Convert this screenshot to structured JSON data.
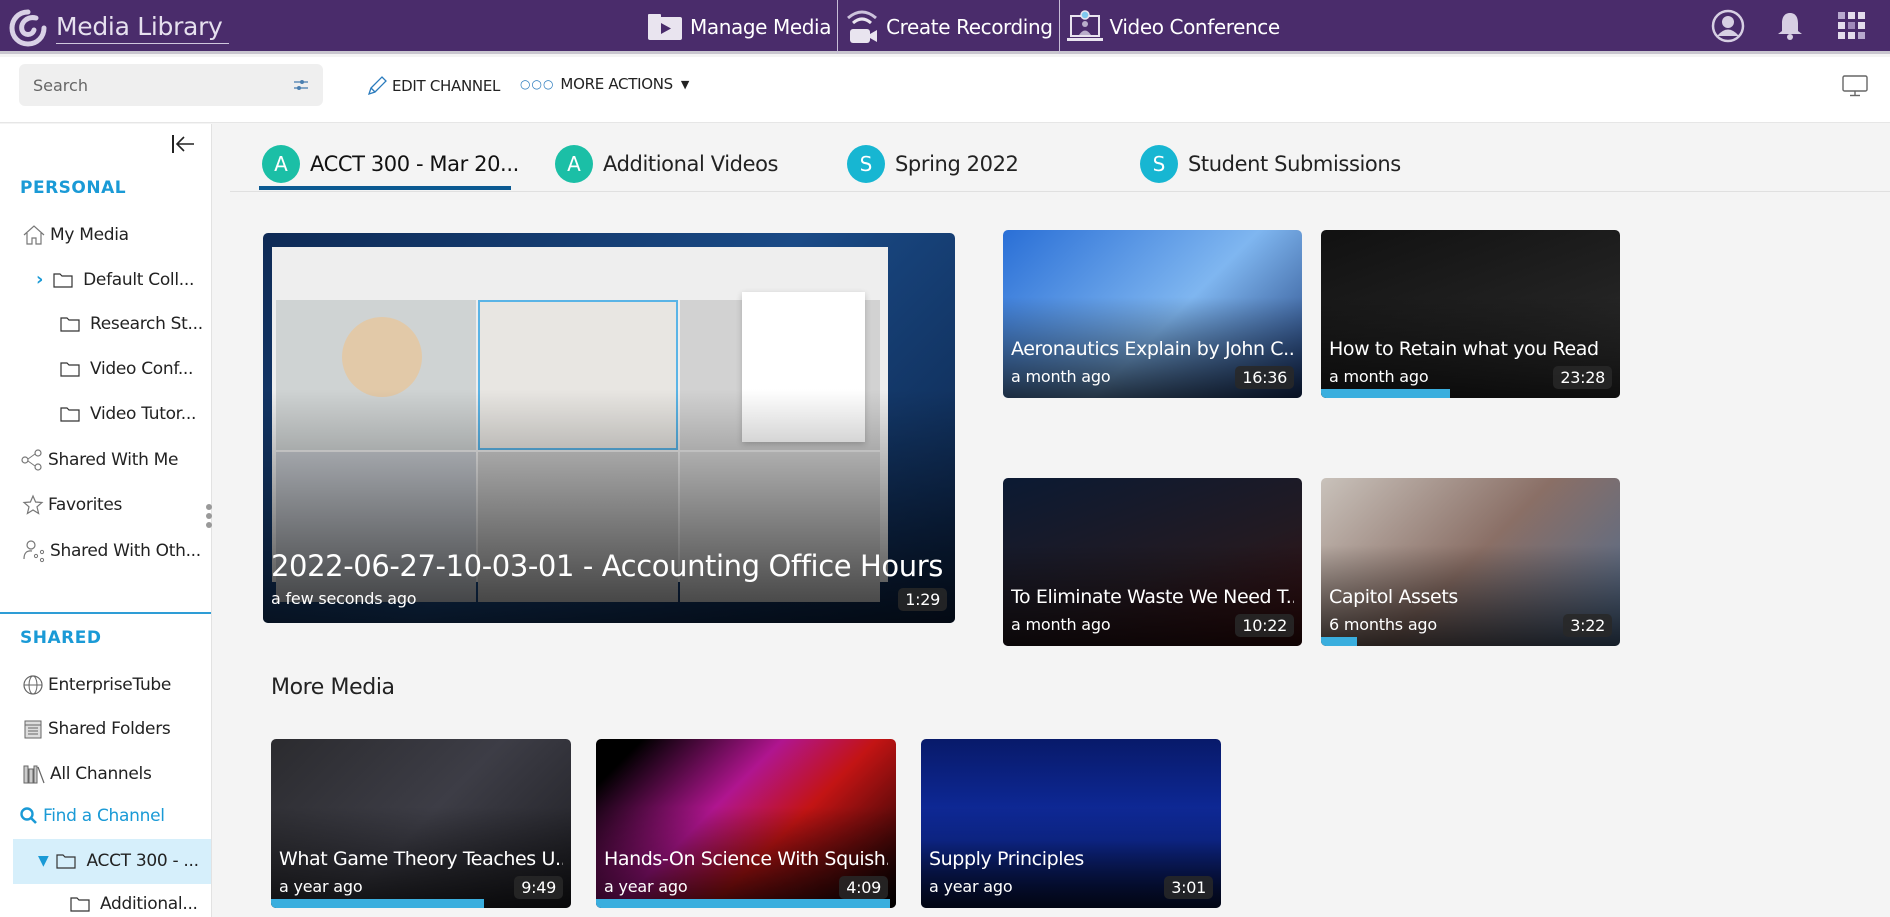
{
  "header": {
    "app_title": "Media Library",
    "nav": [
      {
        "label": "Manage Media",
        "icon": "play-folder-icon"
      },
      {
        "label": "Create Recording",
        "icon": "wireless-camera-icon"
      },
      {
        "label": "Video Conference",
        "icon": "laptop-person-icon"
      }
    ],
    "icons": [
      "user-profile-icon",
      "bell-icon",
      "apps-grid-icon"
    ]
  },
  "toolbar": {
    "search_placeholder": "Search",
    "edit_channel": "EDIT CHANNEL",
    "more_actions": "MORE ACTIONS",
    "more_dots": "○○○"
  },
  "sidebar": {
    "personal_title": "PERSONAL",
    "personal_items": [
      {
        "label": "My Media",
        "icon": "home-icon"
      },
      {
        "label": "Default Coll...",
        "icon": "folder-icon",
        "expander": "chevron-right"
      },
      {
        "label": "Research St...",
        "icon": "folder-icon"
      },
      {
        "label": "Video Conf...",
        "icon": "folder-icon"
      },
      {
        "label": "Video Tutor...",
        "icon": "folder-icon"
      },
      {
        "label": "Shared With Me",
        "icon": "share-icon"
      },
      {
        "label": "Favorites",
        "icon": "star-icon"
      },
      {
        "label": "Shared With Oth...",
        "icon": "user-share-icon"
      }
    ],
    "shared_title": "SHARED",
    "shared_items": [
      {
        "label": "EnterpriseTube",
        "icon": "globe-icon"
      },
      {
        "label": "Shared Folders",
        "icon": "building-icon"
      },
      {
        "label": "All Channels",
        "icon": "books-icon"
      },
      {
        "label": "Find a Channel",
        "icon": "search-icon"
      },
      {
        "label": "ACCT 300 - ...",
        "icon": "folder-icon",
        "expander": "chevron-down",
        "selected": true
      },
      {
        "label": "Additional...",
        "icon": "folder-icon"
      }
    ]
  },
  "tabs": [
    {
      "initial": "A",
      "label": "ACCT 300 - Mar 20...",
      "color": "#1bbfa6",
      "active": true
    },
    {
      "initial": "A",
      "label": "Additional Videos",
      "color": "#1bbfa6",
      "active": false
    },
    {
      "initial": "S",
      "label": "Spring 2022",
      "color": "#17b6d2",
      "active": false
    },
    {
      "initial": "S",
      "label": "Student Submissions",
      "color": "#17b6d2",
      "active": false
    }
  ],
  "featured": {
    "title": "2022-06-27-10-03-01 - Accounting Office Hours",
    "ago": "a few seconds ago",
    "duration": "1:29"
  },
  "grid": [
    {
      "title": "Aeronautics Explain by John C...",
      "ago": "a month ago",
      "duration": "16:36",
      "progress": 0
    },
    {
      "title": "How to Retain what you Read",
      "ago": "a month ago",
      "duration": "23:28",
      "progress": 0.43
    },
    {
      "title": "To Eliminate Waste We Need T...",
      "ago": "a month ago",
      "duration": "10:22",
      "progress": 0
    },
    {
      "title": "Capitol Assets",
      "ago": "6 months ago",
      "duration": "3:22",
      "progress": 0.12
    }
  ],
  "more_media": {
    "heading": "More Media",
    "items": [
      {
        "title": "What Game Theory Teaches U...",
        "ago": "a year ago",
        "duration": "9:49",
        "progress": 0.71
      },
      {
        "title": "Hands-On Science With Squish...",
        "ago": "a year ago",
        "duration": "4:09",
        "progress": 0.98
      },
      {
        "title": "Supply Principles",
        "ago": "a year ago",
        "duration": "3:01",
        "progress": 0
      }
    ]
  },
  "colors": {
    "header_bg": "#4a2c6b",
    "accent_blue": "#1a9ad6",
    "progress": "#3aaede",
    "tab_underline": "#0b5a92"
  }
}
